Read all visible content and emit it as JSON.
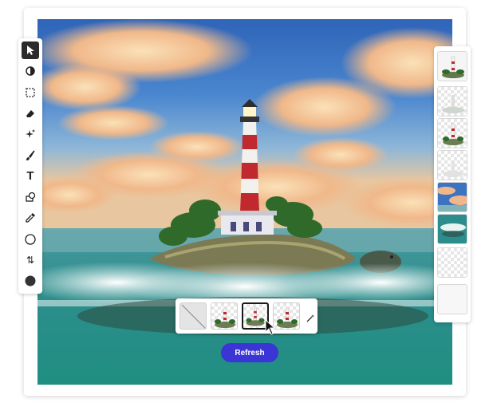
{
  "app": {
    "accent_color": "#3b35d6"
  },
  "toolbar": {
    "tools": [
      {
        "name": "select",
        "icon": "arrow-pointer-icon",
        "active": true
      },
      {
        "name": "adjust",
        "icon": "half-circle-icon"
      },
      {
        "name": "marquee",
        "icon": "dashed-square-icon"
      },
      {
        "name": "eraser",
        "icon": "eraser-icon"
      },
      {
        "name": "generative",
        "icon": "sparkle-icon"
      },
      {
        "name": "brush",
        "icon": "brush-icon"
      },
      {
        "name": "text",
        "icon": "text-icon",
        "glyph": "T"
      },
      {
        "name": "shapes",
        "icon": "shapes-icon"
      },
      {
        "name": "eyedropper",
        "icon": "eyedropper-icon"
      },
      {
        "name": "foreground-color",
        "icon": "circle-outline-icon"
      },
      {
        "name": "swap-colors",
        "icon": "swap-arrows-icon",
        "glyph": "⇅"
      },
      {
        "name": "background-color",
        "icon": "filled-circle-icon"
      }
    ]
  },
  "layers_panel": {
    "thumbnails": [
      {
        "name": "lighthouse-layer",
        "type": "lighthouse"
      },
      {
        "name": "faded-lighthouse-layer",
        "type": "faded-lighthouse"
      },
      {
        "name": "lighthouse-cutout-layer",
        "type": "lighthouse-cutout"
      },
      {
        "name": "ghost-layer",
        "type": "ghost"
      },
      {
        "name": "sky-layer",
        "type": "sky"
      },
      {
        "name": "ocean-layer",
        "type": "ocean"
      },
      {
        "name": "empty-layer",
        "type": "empty"
      },
      {
        "name": "white-layer",
        "type": "white"
      }
    ]
  },
  "variations_bar": {
    "items": [
      {
        "name": "no-variation",
        "type": "none"
      },
      {
        "name": "variation-1",
        "type": "lighthouse"
      },
      {
        "name": "variation-2",
        "type": "lighthouse",
        "selected": true
      },
      {
        "name": "variation-3",
        "type": "lighthouse"
      }
    ],
    "wand_icon": "magic-wand-icon"
  },
  "refresh_button": {
    "label": "Refresh"
  }
}
